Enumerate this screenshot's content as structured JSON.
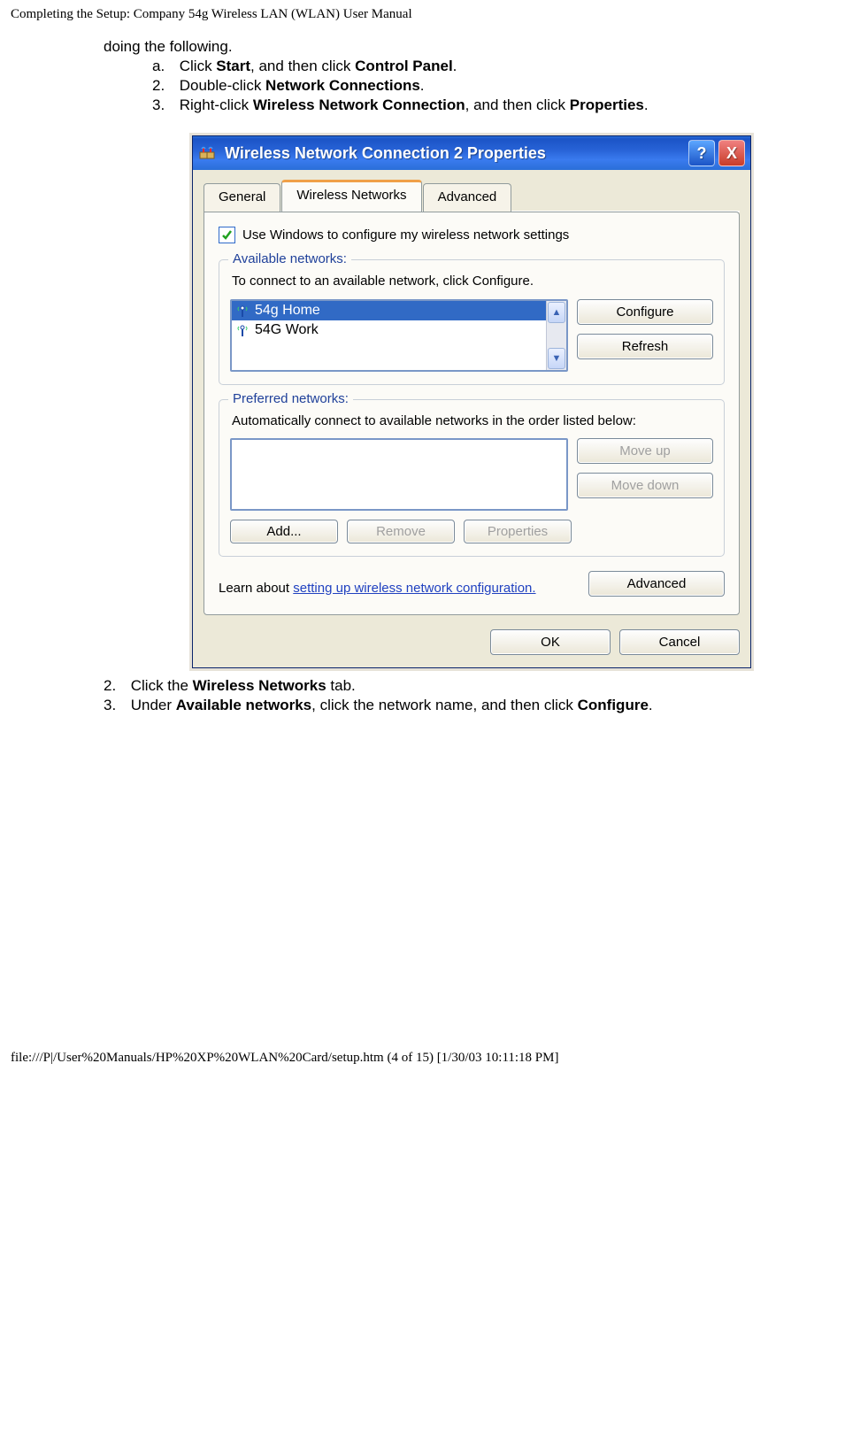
{
  "header": {
    "title": "Completing the Setup: Company 54g Wireless LAN (WLAN) User Manual"
  },
  "body": {
    "lead": "doing the following.",
    "steps1": [
      {
        "marker": "a.",
        "pre": "Click ",
        "b1": "Start",
        "mid": ", and then click ",
        "b2": "Control Panel",
        "post": "."
      },
      {
        "marker": "2.",
        "pre": "Double-click ",
        "b1": "Network Connections",
        "mid": "",
        "b2": "",
        "post": "."
      },
      {
        "marker": "3.",
        "pre": "Right-click ",
        "b1": "Wireless Network Connection",
        "mid": ", and then click ",
        "b2": "Properties",
        "post": "."
      }
    ],
    "steps2": [
      {
        "marker": "2.",
        "pre": "Click the ",
        "b1": "Wireless Networks",
        "mid": "",
        "b2": "",
        "post": " tab."
      },
      {
        "marker": "3.",
        "pre": "Under ",
        "b1": "Available networks",
        "mid": ", click the network name, and then click ",
        "b2": "Configure",
        "post": "."
      }
    ]
  },
  "dialog": {
    "title": "Wireless Network Connection 2 Properties",
    "help_symbol": "?",
    "close_symbol": "X",
    "tabs": {
      "general": "General",
      "wireless": "Wireless Networks",
      "advanced": "Advanced"
    },
    "use_windows_label": "Use Windows to configure my wireless network settings",
    "available": {
      "legend": "Available networks:",
      "desc": "To connect to an available network, click Configure.",
      "items": [
        {
          "name": "54g Home",
          "selected": true
        },
        {
          "name": "54G Work",
          "selected": false
        }
      ],
      "configure": "Configure",
      "refresh": "Refresh"
    },
    "preferred": {
      "legend": "Preferred networks:",
      "desc": "Automatically connect to available networks in the order listed below:",
      "moveup": "Move up",
      "movedown": "Move down",
      "add": "Add...",
      "remove": "Remove",
      "properties": "Properties"
    },
    "learn": {
      "pre": "Learn about ",
      "link": "setting up wireless network configuration."
    },
    "advanced_btn": "Advanced",
    "ok": "OK",
    "cancel": "Cancel"
  },
  "footer": {
    "text": "file:///P|/User%20Manuals/HP%20XP%20WLAN%20Card/setup.htm (4 of 15) [1/30/03 10:11:18 PM]"
  }
}
